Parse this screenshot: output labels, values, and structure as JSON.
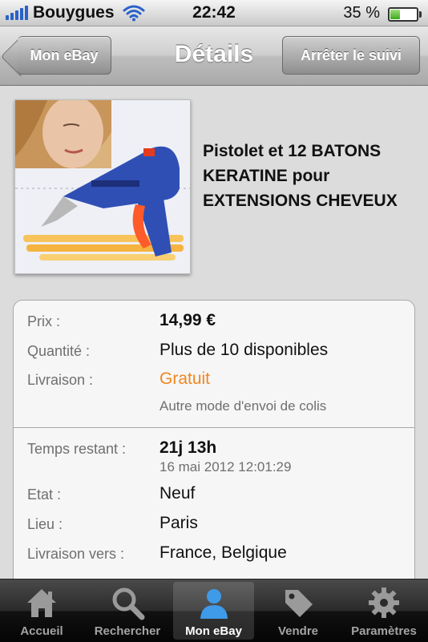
{
  "status_bar": {
    "carrier": "Bouygues",
    "time": "22:42",
    "battery": "35 %",
    "battery_level": 0.35
  },
  "nav": {
    "back_label": "Mon eBay",
    "title": "Détails",
    "action_label": "Arrêter le suivi"
  },
  "product": {
    "title": "Pistolet et 12 BATONS KERATINE pour EXTENSIONS CHEVEUX"
  },
  "details": {
    "price_label": "Prix :",
    "price_value": "14,99 €",
    "quantity_label": "Quantité :",
    "quantity_value": "Plus de 10 disponibles",
    "delivery_label": "Livraison :",
    "delivery_value": "Gratuit",
    "delivery_note": "Autre mode d'envoi de colis",
    "time_left_label": "Temps restant :",
    "time_left_value": "21j 13h",
    "end_date": "16 mai 2012 12:01:29",
    "condition_label": "Etat :",
    "condition_value": "Neuf",
    "location_label": "Lieu :",
    "location_value": "Paris",
    "ships_to_label": "Livraison vers :",
    "ships_to_value": "France, Belgique"
  },
  "tabs": [
    {
      "label": "Accueil",
      "icon": "home-icon",
      "active": false
    },
    {
      "label": "Rechercher",
      "icon": "search-icon",
      "active": false
    },
    {
      "label": "Mon eBay",
      "icon": "user-icon",
      "active": true
    },
    {
      "label": "Vendre",
      "icon": "tag-icon",
      "active": false
    },
    {
      "label": "Paramètres",
      "icon": "gear-icon",
      "active": false
    }
  ],
  "colors": {
    "accent_orange": "#f0871f",
    "active_tab_icon": "#3f9ae8"
  }
}
